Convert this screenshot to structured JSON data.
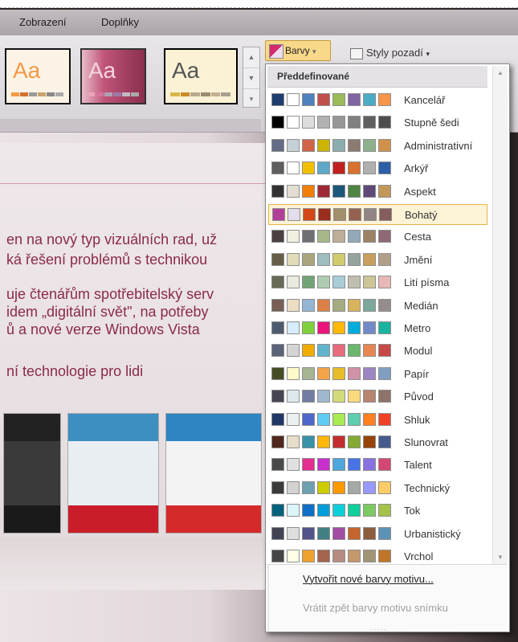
{
  "menu": {
    "zobrazeni": "Zobrazení",
    "doplnky": "Doplňky"
  },
  "ribbon": {
    "thumb_text": "Aa",
    "barvy_label": "Barvy",
    "barvy_arrow": "▾",
    "styly_label": "Styly pozadí",
    "styly_arrow": "▾",
    "scroll_up": "▲",
    "scroll_down": "▼",
    "scroll_more": "▾"
  },
  "slide": {
    "line1": "en na nový typ vizuálních rad, už",
    "line2": "ká řešení problémů s technikou",
    "line3": "uje čtenářům spotřebitelský serv",
    "line4": "idem „digitální svět\", na potřeby",
    "line5": "ů a nové verze Windows Vista",
    "line6": "ní technologie pro lidi"
  },
  "dropdown": {
    "header": "Předdefinované",
    "scroll_up": "▲",
    "scroll_down": "▼",
    "items": [
      {
        "label": "Kancelář",
        "colors": [
          "#1f3d6e",
          "#ffffff",
          "#4f81bd",
          "#c0504d",
          "#9bbb59",
          "#8064a2",
          "#4bacc6",
          "#f79646"
        ]
      },
      {
        "label": "Stupně šedi",
        "colors": [
          "#000000",
          "#ffffff",
          "#dddddd",
          "#b2b2b2",
          "#969696",
          "#808080",
          "#5f5f5f",
          "#4d4d4d"
        ]
      },
      {
        "label": "Administrativní",
        "colors": [
          "#646b86",
          "#c5d1d7",
          "#d16349",
          "#ccb400",
          "#8cadae",
          "#8c7b70",
          "#8fb08c",
          "#d19049"
        ]
      },
      {
        "label": "Arkýř",
        "colors": [
          "#5e5e5e",
          "#ffffff",
          "#f0c000",
          "#5ea9c8",
          "#c02020",
          "#d9722f",
          "#b0b0b0",
          "#2d5ea8"
        ]
      },
      {
        "label": "Aspekt",
        "colors": [
          "#323232",
          "#e3ded1",
          "#f07f09",
          "#9f2936",
          "#1b587c",
          "#4e8542",
          "#604878",
          "#c19859"
        ]
      },
      {
        "label": "Bohatý",
        "colors": [
          "#b13f9a",
          "#e3dded",
          "#d34817",
          "#9b2d1f",
          "#a28e6a",
          "#956251",
          "#918485",
          "#855d5d"
        ]
      },
      {
        "label": "Cesta",
        "colors": [
          "#4a4040",
          "#f1efe0",
          "#6f6f74",
          "#a7b789",
          "#beae98",
          "#92a9b9",
          "#9c8265",
          "#8d6974"
        ]
      },
      {
        "label": "Jmění",
        "colors": [
          "#675e47",
          "#dfdcb7",
          "#a9a57c",
          "#9cbebd",
          "#d2cb6c",
          "#95a39d",
          "#c89f5d",
          "#b1a089"
        ]
      },
      {
        "label": "Lití písma",
        "colors": [
          "#676a55",
          "#eaebde",
          "#72a376",
          "#b0ccb0",
          "#a8cdd7",
          "#c0beaf",
          "#cec597",
          "#e8b7b7"
        ]
      },
      {
        "label": "Medián",
        "colors": [
          "#775f55",
          "#ebddc3",
          "#94b6d2",
          "#dd8047",
          "#a5ab81",
          "#d8b25c",
          "#7ba79d",
          "#968c8c"
        ]
      },
      {
        "label": "Metro",
        "colors": [
          "#4e5b6f",
          "#d6ecff",
          "#7fd13b",
          "#ea157a",
          "#feb80a",
          "#00addc",
          "#738ac8",
          "#1ab39f"
        ]
      },
      {
        "label": "Modul",
        "colors": [
          "#5a6378",
          "#d4d4d4",
          "#f0ad00",
          "#60b5cc",
          "#e66c7d",
          "#6bb76d",
          "#e88651",
          "#c64847"
        ]
      },
      {
        "label": "Papír",
        "colors": [
          "#444d26",
          "#fefac9",
          "#a5b592",
          "#f3a447",
          "#e7bc29",
          "#d092a7",
          "#9c85c0",
          "#809ec2"
        ]
      },
      {
        "label": "Původ",
        "colors": [
          "#464653",
          "#dde9ec",
          "#727ca3",
          "#9fb8cd",
          "#d2da7a",
          "#fada7a",
          "#b88472",
          "#8e736a"
        ]
      },
      {
        "label": "Shluk",
        "colors": [
          "#213765",
          "#ecf0f3",
          "#4e67c8",
          "#5eccf3",
          "#a7ea52",
          "#5dceaf",
          "#ff8021",
          "#f14124"
        ]
      },
      {
        "label": "Slunovrat",
        "colors": [
          "#4f271c",
          "#e7dec9",
          "#3891a7",
          "#feb80a",
          "#c32d2e",
          "#84aa33",
          "#964305",
          "#475a8d"
        ]
      },
      {
        "label": "Talent",
        "colors": [
          "#4a4a4a",
          "#e0e0e0",
          "#e32d91",
          "#c830cc",
          "#4ea6dc",
          "#4775e7",
          "#8971e1",
          "#d54773"
        ]
      },
      {
        "label": "Technický",
        "colors": [
          "#3b3b3b",
          "#d4d2d0",
          "#6ea0b0",
          "#cccc00",
          "#ff9900",
          "#a4aaa6",
          "#9999ff",
          "#ffcc66"
        ]
      },
      {
        "label": "Tok",
        "colors": [
          "#04617b",
          "#dbf5f9",
          "#0f6fc6",
          "#009dd9",
          "#0bd0d9",
          "#10cf9b",
          "#7cca62",
          "#a5c249"
        ]
      },
      {
        "label": "Urbanistický",
        "colors": [
          "#424456",
          "#dedede",
          "#53548a",
          "#438086",
          "#a04da3",
          "#c4652d",
          "#8b5d3d",
          "#5c92b5"
        ]
      },
      {
        "label": "Vrchol",
        "colors": [
          "#464646",
          "#fffde6",
          "#f0a22e",
          "#a5644e",
          "#b58b80",
          "#c3986d",
          "#a19574",
          "#c17529"
        ]
      }
    ],
    "create_new": "Vytvořit nové barvy motivu...",
    "reset": "Vrátit zpět barvy motivu snímku",
    "grip": "....."
  },
  "colors": {
    "selection_border": "#e8b34a",
    "barvy_bg": "#f8d889",
    "accent_pink": "#8a2b49"
  }
}
